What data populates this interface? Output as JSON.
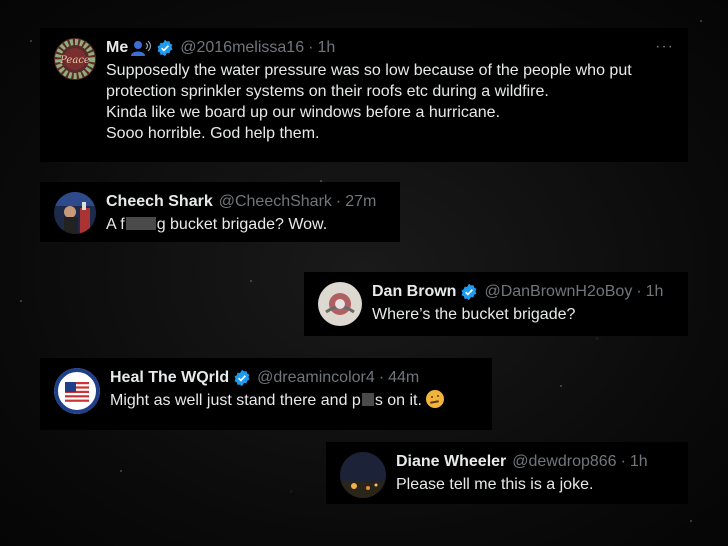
{
  "tweets": [
    {
      "name": "Me",
      "handle": "@2016melissa16",
      "time": "1h",
      "lines": [
        "Supposedly the water pressure was so low because of the people who put",
        "protection sprinkler systems on their roofs etc during a wildfire.",
        "Kinda like we board up our windows before a hurricane.",
        "Sooo horrible. God help them."
      ],
      "more": "···",
      "avatar_label": "Peace"
    },
    {
      "name": "Cheech Shark",
      "handle": "@CheechShark",
      "time": "27m",
      "text_before": "A f",
      "text_after": "g bucket brigade?  Wow."
    },
    {
      "name": "Dan Brown",
      "handle": "@DanBrownH2oBoy",
      "time": "1h",
      "text": "Where’s the bucket brigade?"
    },
    {
      "name": "Heal The WQrld",
      "handle": "@dreamincolor4",
      "time": "44m",
      "text_before": "Might as well just stand there and p",
      "text_after": "s on it.",
      "emoji": "thinking-face"
    },
    {
      "name": "Diane Wheeler",
      "handle": "@dewdrop866",
      "time": "1h",
      "text": "Please tell me this is a joke."
    }
  ],
  "separator": "·",
  "colors": {
    "verified": "#1d9bf0",
    "muted": "#71767b",
    "text": "#e7e9ea",
    "card_bg": "#000000"
  }
}
